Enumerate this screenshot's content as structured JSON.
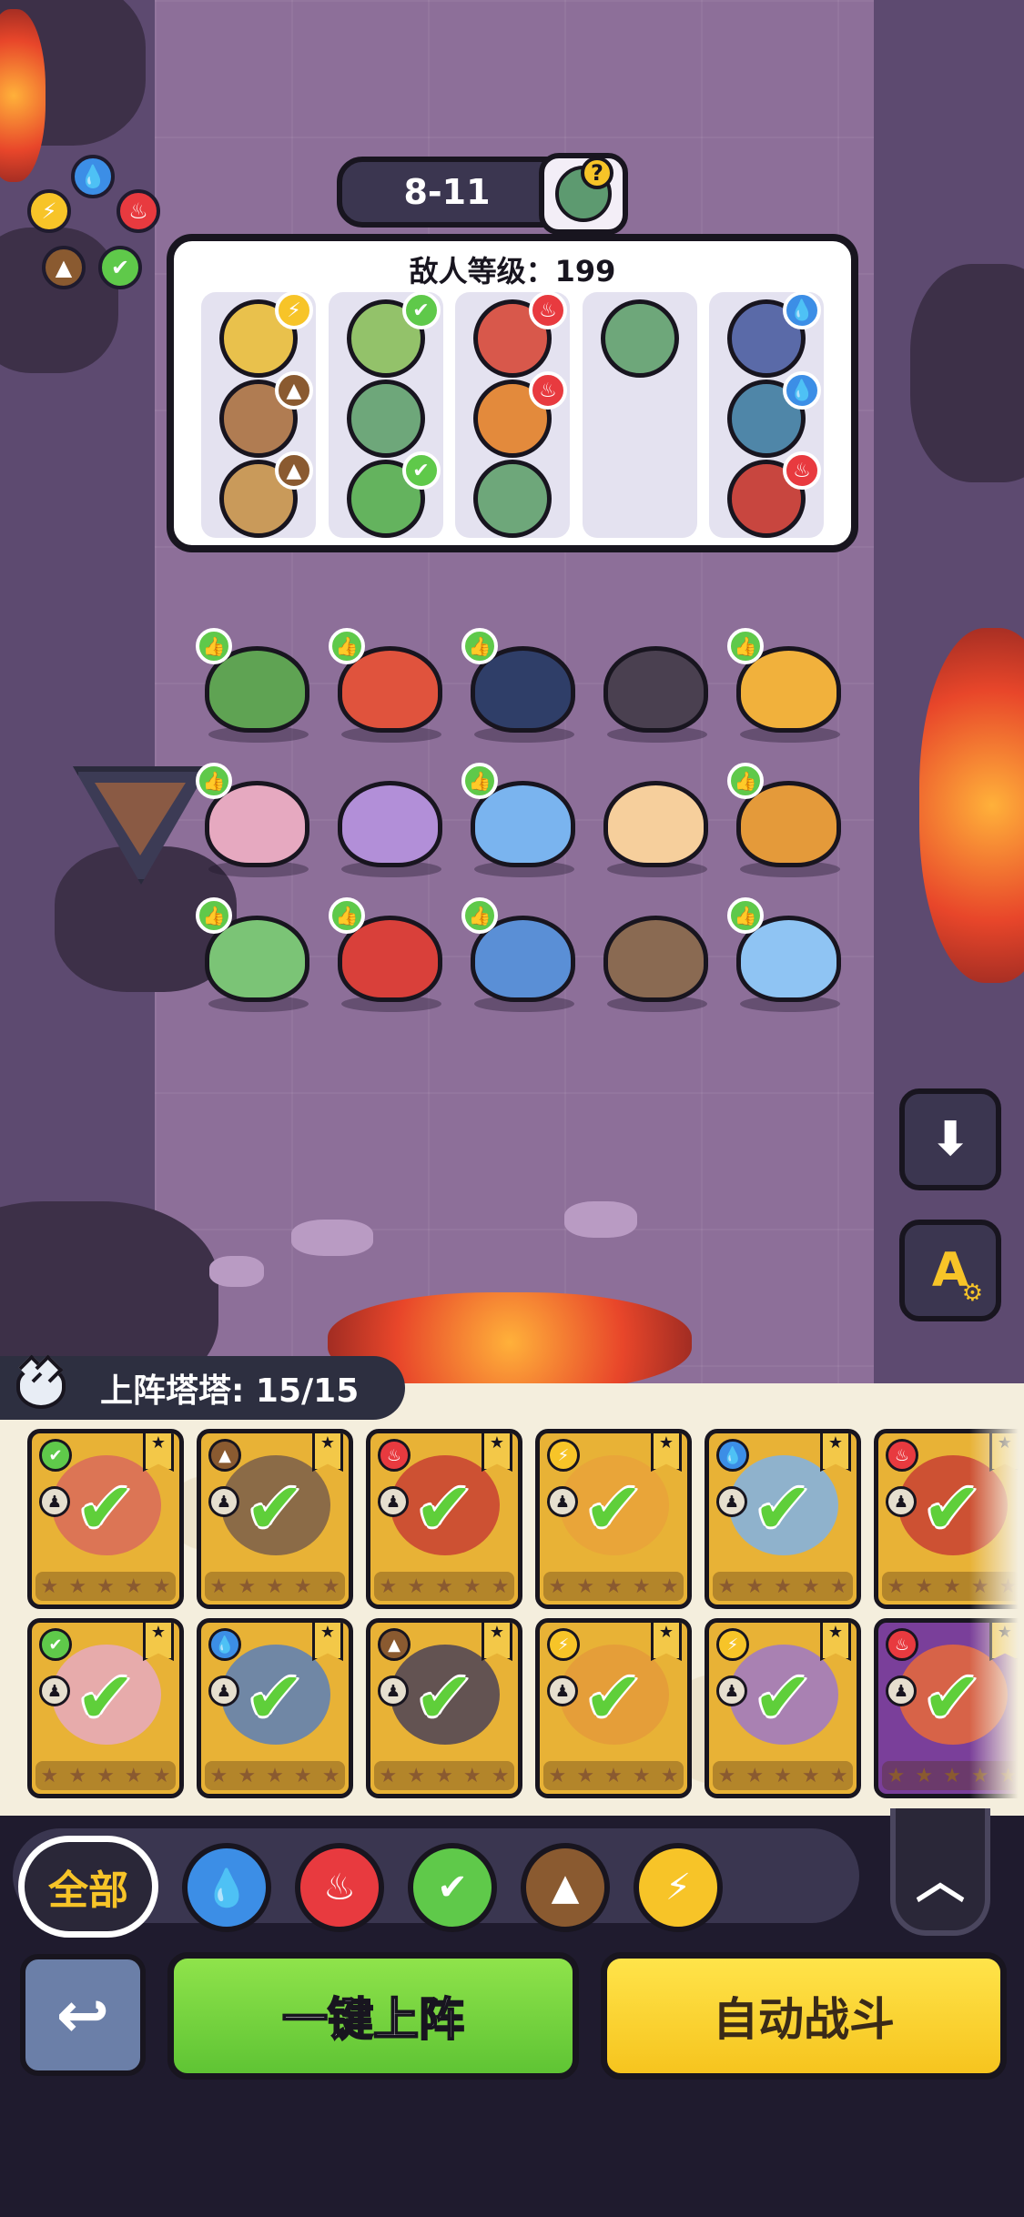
{
  "stage": {
    "label": "8-11",
    "boss_hint": "?"
  },
  "enemy_panel": {
    "title": "敌人等级：199",
    "columns": [
      [
        {
          "color": "#e9c14c",
          "badge": "bolt"
        },
        {
          "color": "#b07c52",
          "badge": "earth"
        },
        {
          "color": "#c99a5a",
          "badge": "earth"
        }
      ],
      [
        {
          "color": "#93c26a",
          "badge": "leaf"
        },
        {
          "color": "#6ea77a",
          "badge": ""
        },
        {
          "color": "#64b35e",
          "badge": "leaf"
        }
      ],
      [
        {
          "color": "#d8584b",
          "badge": "fire"
        },
        {
          "color": "#e38a3c",
          "badge": "fire"
        },
        {
          "color": "#6ea77a",
          "badge": ""
        }
      ],
      [
        {
          "color": "#6ea77a",
          "badge": ""
        }
      ],
      [
        {
          "color": "#5a6aa8",
          "badge": "water"
        },
        {
          "color": "#4f86a8",
          "badge": "water"
        },
        {
          "color": "#c8463f",
          "badge": "fire"
        }
      ]
    ]
  },
  "badge_glyphs": {
    "bolt": "⚡",
    "earth": "▲",
    "leaf": "✔",
    "fire": "♨",
    "water": "💧"
  },
  "badge_colors": {
    "bolt": "#f7c428",
    "earth": "#8a5a30",
    "leaf": "#5fc94a",
    "fire": "#e83a3f",
    "water": "#3c8ee6"
  },
  "player_units": [
    {
      "row": 0,
      "col": 0,
      "color": "#5fa353",
      "liked": true
    },
    {
      "row": 0,
      "col": 1,
      "color": "#e0533d",
      "liked": true
    },
    {
      "row": 0,
      "col": 2,
      "color": "#2f3e68",
      "liked": true
    },
    {
      "row": 0,
      "col": 3,
      "color": "#4a4050",
      "liked": false
    },
    {
      "row": 0,
      "col": 4,
      "color": "#f1b13c",
      "liked": true
    },
    {
      "row": 1,
      "col": 0,
      "color": "#e6a9c0",
      "liked": true
    },
    {
      "row": 1,
      "col": 1,
      "color": "#b28fd8",
      "liked": false
    },
    {
      "row": 1,
      "col": 2,
      "color": "#7ab4ef",
      "liked": true
    },
    {
      "row": 1,
      "col": 3,
      "color": "#f6cf9c",
      "liked": false
    },
    {
      "row": 1,
      "col": 4,
      "color": "#e49a3a",
      "liked": true
    },
    {
      "row": 2,
      "col": 0,
      "color": "#7bc476",
      "liked": true
    },
    {
      "row": 2,
      "col": 1,
      "color": "#d9403a",
      "liked": true
    },
    {
      "row": 2,
      "col": 2,
      "color": "#5a8fd6",
      "liked": true
    },
    {
      "row": 2,
      "col": 3,
      "color": "#8a6a52",
      "liked": false
    },
    {
      "row": 2,
      "col": 4,
      "color": "#8fc4f3",
      "liked": true
    }
  ],
  "roster": {
    "label": "上阵塔塔: 15/15",
    "cards": [
      {
        "el": "leaf",
        "color": "#d96a5b",
        "bg": "#e8b236",
        "checked": true
      },
      {
        "el": "earth",
        "color": "#7a5e4a",
        "bg": "#e8b236",
        "checked": true
      },
      {
        "el": "fire",
        "color": "#c84032",
        "bg": "#e8b236",
        "checked": true
      },
      {
        "el": "bolt",
        "color": "#e9a23a",
        "bg": "#e8b236",
        "checked": true
      },
      {
        "el": "water",
        "color": "#7fb2e6",
        "bg": "#e8b236",
        "checked": true
      },
      {
        "el": "fire",
        "color": "#c84032",
        "bg": "#e8b236",
        "checked": true
      },
      {
        "el": "leaf",
        "color": "#e6a9c0",
        "bg": "#e8b236",
        "checked": true
      },
      {
        "el": "water",
        "color": "#5b7fb8",
        "bg": "#e8b236",
        "checked": true
      },
      {
        "el": "earth",
        "color": "#4b4257",
        "bg": "#e8b236",
        "checked": true
      },
      {
        "el": "bolt",
        "color": "#e49a3a",
        "bg": "#e8b236",
        "checked": true
      },
      {
        "el": "bolt",
        "color": "#9d78c8",
        "bg": "#e8b236",
        "checked": true
      },
      {
        "el": "fire",
        "color": "#e86a3a",
        "bg": "#7a3f9a",
        "checked": true
      }
    ],
    "role_glyph": "♟",
    "star_glyph": "★",
    "check_glyph": "✔"
  },
  "filters": {
    "all_label": "全部",
    "elements": [
      "water",
      "fire",
      "leaf",
      "earth",
      "bolt"
    ]
  },
  "buttons": {
    "deploy": "一键上阵",
    "auto_battle": "自动战斗",
    "back": "↩",
    "collapse": "︿",
    "download": "⬇",
    "auto_settings": "A"
  },
  "wheel": [
    "water",
    "fire",
    "leaf",
    "earth",
    "bolt"
  ]
}
